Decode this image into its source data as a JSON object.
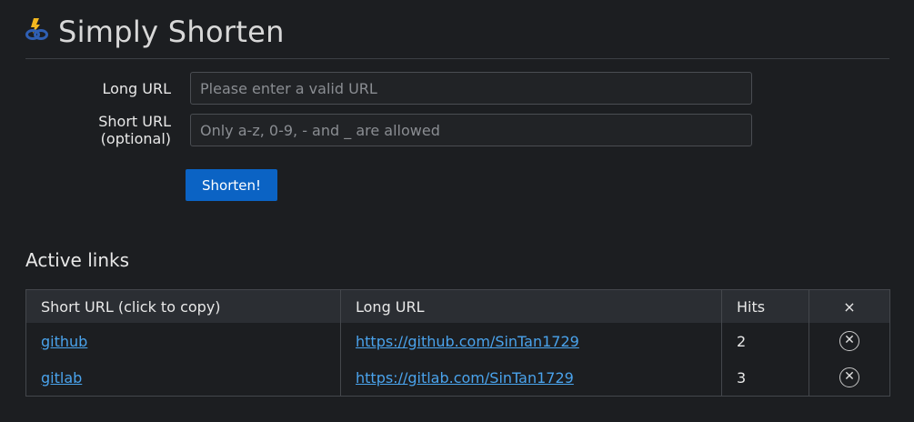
{
  "app": {
    "title": "Simply Shorten",
    "colors": {
      "accent": "#0b63c4",
      "link": "#4aa3ec",
      "background": "#1c1e21"
    }
  },
  "form": {
    "long_url": {
      "label": "Long URL",
      "placeholder": "Please enter a valid URL",
      "value": ""
    },
    "short_url": {
      "label_line1": "Short URL",
      "label_line2": "(optional)",
      "placeholder": "Only a-z, 0-9, - and _ are allowed",
      "value": ""
    },
    "submit_label": "Shorten!"
  },
  "links_section": {
    "title": "Active links",
    "columns": [
      "Short URL (click to copy)",
      "Long URL",
      "Hits",
      "×"
    ],
    "rows": [
      {
        "short": "github",
        "long": "https://github.com/SinTan1729",
        "hits": "2",
        "delete_icon": "close-circle-icon"
      },
      {
        "short": "gitlab",
        "long": "https://gitlab.com/SinTan1729",
        "hits": "3",
        "delete_icon": "close-circle-icon"
      }
    ]
  }
}
